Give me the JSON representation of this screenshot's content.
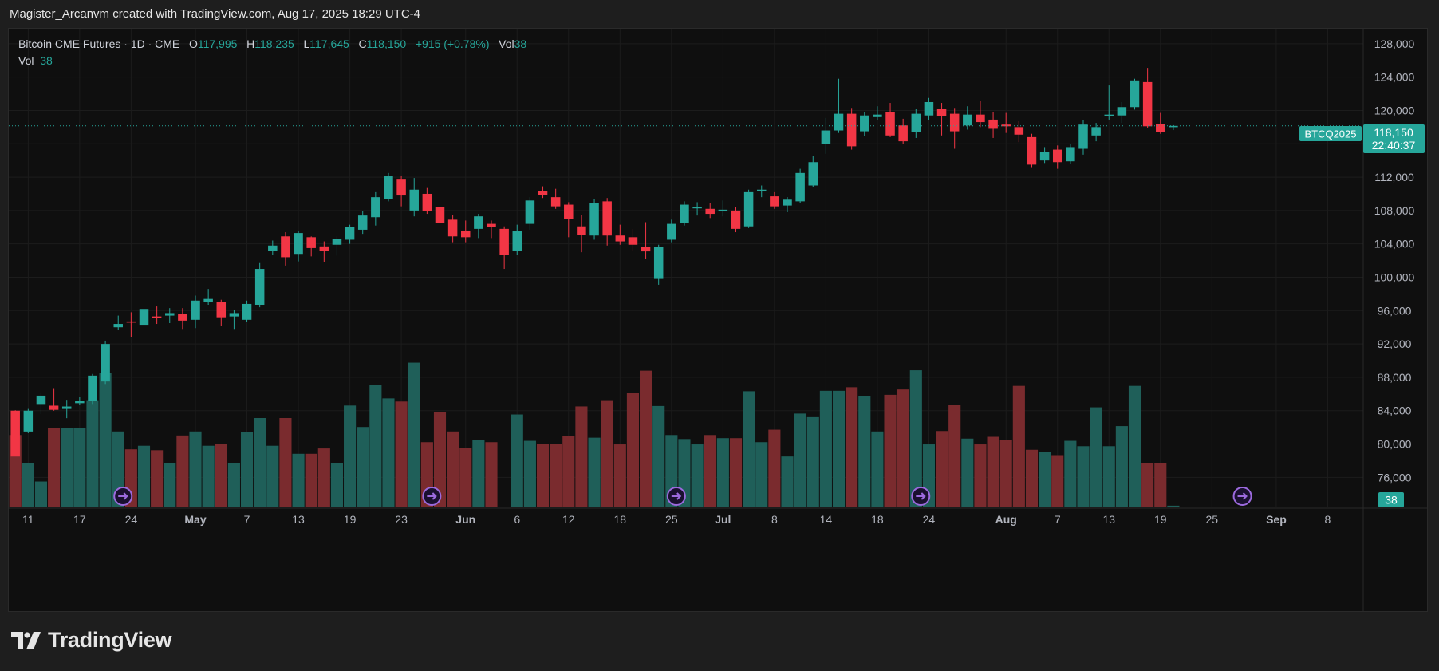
{
  "header": {
    "credit": "Magister_Arcanvm created with TradingView.com, Aug 17, 2025 18:29 UTC-4"
  },
  "legend": {
    "symbol": "Bitcoin CME Futures · 1D · CME",
    "o_label": "O",
    "o_value": "117,995",
    "h_label": "H",
    "h_value": "118,235",
    "l_label": "L",
    "l_value": "117,645",
    "c_label": "C",
    "c_value": "118,150",
    "change": "+915 (+0.78%)",
    "vol_label": "Vol",
    "vol_value": "38",
    "vol_row_label": "Vol",
    "vol_row_value": "38"
  },
  "price_tag": {
    "symbol": "BTCQ2025",
    "price": "118,150",
    "countdown": "22:40:37",
    "volume": "38"
  },
  "brand": {
    "name": "TradingView"
  },
  "colors": {
    "up": "#26a69a",
    "down": "#f23645",
    "up_volume": "#1f5f59",
    "down_volume": "#7a2b2e",
    "grid": "#1c1c1c",
    "event_marker": "#9c6ade"
  },
  "chart_data": {
    "type": "candlestick",
    "title": "Bitcoin CME Futures · 1D · CME",
    "ylim": [
      72400,
      129800
    ],
    "y_ticks": [
      128000,
      124000,
      120000,
      116000,
      112000,
      108000,
      104000,
      100000,
      96000,
      92000,
      88000,
      84000,
      80000,
      76000
    ],
    "y_tick_labels": [
      "128,000",
      "124,000",
      "120,000",
      "116,000",
      "112,000",
      "108,000",
      "104,000",
      "100,000",
      "96,000",
      "92,000",
      "88,000",
      "84,000",
      "80,000",
      "76,000"
    ],
    "x_tick_labels": [
      {
        "label": "11",
        "bar": 1
      },
      {
        "label": "17",
        "bar": 5
      },
      {
        "label": "24",
        "bar": 9
      },
      {
        "label": "May",
        "bar": 14,
        "bold": true
      },
      {
        "label": "7",
        "bar": 18
      },
      {
        "label": "13",
        "bar": 22
      },
      {
        "label": "19",
        "bar": 26
      },
      {
        "label": "23",
        "bar": 30
      },
      {
        "label": "Jun",
        "bar": 35,
        "bold": true
      },
      {
        "label": "6",
        "bar": 39
      },
      {
        "label": "12",
        "bar": 43
      },
      {
        "label": "18",
        "bar": 47
      },
      {
        "label": "25",
        "bar": 51
      },
      {
        "label": "Jul",
        "bar": 55,
        "bold": true
      },
      {
        "label": "8",
        "bar": 59
      },
      {
        "label": "14",
        "bar": 63
      },
      {
        "label": "18",
        "bar": 67
      },
      {
        "label": "24",
        "bar": 71
      },
      {
        "label": "Aug",
        "bar": 77,
        "bold": true
      },
      {
        "label": "7",
        "bar": 81
      },
      {
        "label": "13",
        "bar": 85
      },
      {
        "label": "19",
        "bar": 89
      },
      {
        "label": "25",
        "bar": 93
      },
      {
        "label": "Sep",
        "bar": 98,
        "bold": true
      },
      {
        "label": "8",
        "bar": 102
      }
    ],
    "last_price": 118150,
    "event_marker_bars": [
      8,
      32,
      51,
      70,
      95
    ],
    "candles": [
      [
        84000,
        78500,
        84050,
        78550,
        1620
      ],
      [
        81500,
        84000,
        84300,
        81300,
        1000
      ],
      [
        84800,
        85800,
        86200,
        83600,
        580
      ],
      [
        84600,
        84100,
        86700,
        84000,
        1780
      ],
      [
        84300,
        84500,
        85300,
        83100,
        1780
      ],
      [
        84900,
        85200,
        85600,
        84700,
        1780
      ],
      [
        85200,
        88200,
        88400,
        84800,
        2400
      ],
      [
        87500,
        92000,
        92400,
        87200,
        3000
      ],
      [
        94000,
        94400,
        95400,
        93700,
        1700
      ],
      [
        94700,
        94600,
        95800,
        92800,
        1300
      ],
      [
        94300,
        96200,
        96700,
        93500,
        1380
      ],
      [
        95300,
        95200,
        96500,
        94400,
        1280
      ],
      [
        95400,
        95700,
        96300,
        94500,
        1000
      ],
      [
        95600,
        94800,
        96300,
        93800,
        1610
      ],
      [
        94900,
        97200,
        97800,
        93900,
        1700
      ],
      [
        97000,
        97400,
        98600,
        96700,
        1380
      ],
      [
        97000,
        95200,
        97300,
        94200,
        1420
      ],
      [
        95300,
        95700,
        96100,
        93800,
        1000
      ],
      [
        94900,
        96800,
        97200,
        94600,
        1680
      ],
      [
        96700,
        101000,
        101700,
        96400,
        2000
      ],
      [
        103200,
        103800,
        104400,
        102700,
        1380
      ],
      [
        104900,
        102400,
        105400,
        101400,
        2000
      ],
      [
        102800,
        105300,
        105600,
        101900,
        1200
      ],
      [
        104800,
        103500,
        104900,
        102500,
        1200
      ],
      [
        103700,
        103200,
        104300,
        101800,
        1320
      ],
      [
        103900,
        104600,
        104900,
        102600,
        1000
      ],
      [
        104500,
        106000,
        106300,
        104000,
        2280
      ],
      [
        105700,
        107400,
        107900,
        105200,
        1800
      ],
      [
        107200,
        109600,
        110200,
        106200,
        2740
      ],
      [
        109400,
        112100,
        112500,
        109100,
        2440
      ],
      [
        111800,
        109800,
        112200,
        108500,
        2370
      ],
      [
        108000,
        110500,
        111900,
        107300,
        3240
      ],
      [
        110000,
        107900,
        110700,
        107600,
        1460
      ],
      [
        108400,
        106500,
        108500,
        105700,
        2140
      ],
      [
        106900,
        104900,
        107500,
        104200,
        1700
      ],
      [
        105600,
        104800,
        106800,
        104200,
        1330
      ],
      [
        105800,
        107300,
        107600,
        104700,
        1510
      ],
      [
        106400,
        106000,
        106800,
        104700,
        1460
      ],
      [
        105800,
        102700,
        106100,
        101000,
        0
      ],
      [
        103200,
        105500,
        106300,
        102700,
        2080
      ],
      [
        106400,
        109200,
        109600,
        105700,
        1490
      ],
      [
        110300,
        109900,
        110900,
        109500,
        1420
      ],
      [
        109600,
        108500,
        110600,
        108200,
        1420
      ],
      [
        108700,
        107000,
        109000,
        104800,
        1590
      ],
      [
        106100,
        105100,
        107500,
        103000,
        2260
      ],
      [
        105000,
        108900,
        109400,
        104500,
        1560
      ],
      [
        109100,
        105000,
        109500,
        103800,
        2400
      ],
      [
        105000,
        104300,
        106300,
        103900,
        1410
      ],
      [
        104800,
        103900,
        105800,
        103100,
        2560
      ],
      [
        103600,
        103100,
        106600,
        102200,
        3060
      ],
      [
        99800,
        103600,
        103900,
        99100,
        2270
      ],
      [
        104500,
        106400,
        106900,
        104200,
        1620
      ],
      [
        106500,
        108700,
        109100,
        106200,
        1530
      ],
      [
        108400,
        108400,
        109000,
        107400,
        1410
      ],
      [
        108200,
        107600,
        108900,
        107100,
        1620
      ],
      [
        108000,
        108100,
        109200,
        107300,
        1550
      ],
      [
        108000,
        105800,
        108400,
        105400,
        1550
      ],
      [
        106100,
        110200,
        110500,
        105900,
        2600
      ],
      [
        110300,
        110500,
        111000,
        109600,
        1460
      ],
      [
        109700,
        108500,
        110200,
        108200,
        1740
      ],
      [
        108600,
        109300,
        109600,
        107800,
        1140
      ],
      [
        109100,
        112500,
        113000,
        108900,
        2100
      ],
      [
        111000,
        113800,
        114500,
        110800,
        2020
      ],
      [
        116000,
        117600,
        119100,
        114800,
        2610
      ],
      [
        117600,
        119600,
        123800,
        117300,
        2610
      ],
      [
        119600,
        115700,
        120300,
        115300,
        2690
      ],
      [
        117500,
        119400,
        119800,
        116900,
        2500
      ],
      [
        119200,
        119500,
        120500,
        118800,
        1700
      ],
      [
        119800,
        117000,
        120900,
        116800,
        2520
      ],
      [
        118200,
        116300,
        119000,
        116000,
        2640
      ],
      [
        117400,
        119600,
        120200,
        116700,
        3070
      ],
      [
        119400,
        121000,
        121500,
        118800,
        1410
      ],
      [
        120200,
        119300,
        120900,
        117000,
        1710
      ],
      [
        119600,
        117500,
        120300,
        115400,
        2290
      ],
      [
        118200,
        119500,
        120500,
        117700,
        1540
      ],
      [
        119500,
        118600,
        121100,
        118000,
        1410
      ],
      [
        118900,
        117800,
        119800,
        116700,
        1580
      ],
      [
        118300,
        118100,
        119700,
        117300,
        1500
      ],
      [
        118000,
        117100,
        118700,
        116200,
        2720
      ],
      [
        116800,
        113500,
        117200,
        113200,
        1290
      ],
      [
        114000,
        115000,
        115600,
        113700,
        1250
      ],
      [
        115300,
        113800,
        115800,
        113000,
        1170
      ],
      [
        113900,
        115600,
        116000,
        113600,
        1490
      ],
      [
        115400,
        118300,
        118800,
        114700,
        1370
      ],
      [
        117000,
        118000,
        118500,
        116300,
        2240
      ],
      [
        119400,
        119500,
        123000,
        118900,
        1370
      ],
      [
        119400,
        120400,
        121000,
        118500,
        1820
      ],
      [
        120400,
        123600,
        123800,
        120100,
        2720
      ],
      [
        123400,
        118100,
        125100,
        117900,
        1000
      ],
      [
        118400,
        117400,
        119700,
        117200,
        1000
      ],
      [
        117995,
        118150,
        118235,
        117645,
        38
      ]
    ]
  }
}
